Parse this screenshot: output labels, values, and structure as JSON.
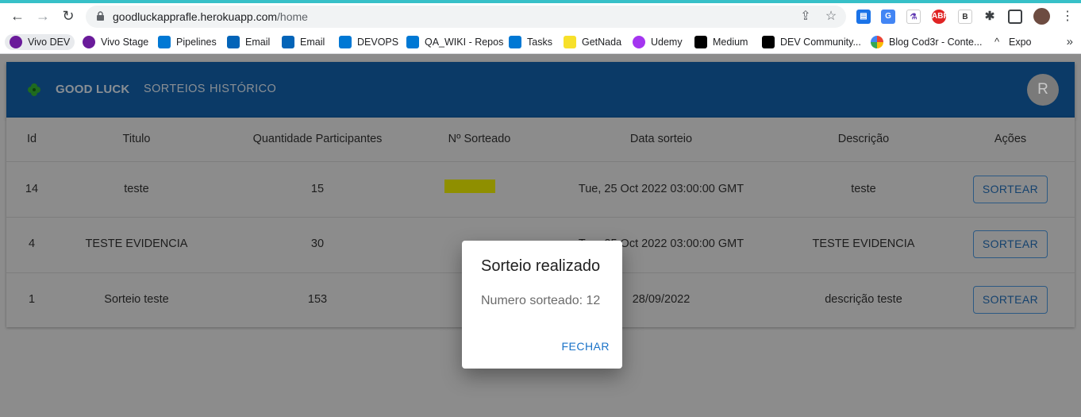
{
  "browser": {
    "url_host": "goodluckapprafle.herokuapp.com",
    "url_path": "/home",
    "bookmarks": [
      {
        "label": "Vivo DEV",
        "icon": "vivo-icon"
      },
      {
        "label": "Vivo Stage",
        "icon": "vivo-icon"
      },
      {
        "label": "Pipelines",
        "icon": "azure-devops-icon"
      },
      {
        "label": "Email",
        "icon": "outlook-icon"
      },
      {
        "label": "Email",
        "icon": "outlook-icon"
      },
      {
        "label": "DEVOPS",
        "icon": "azure-devops-icon"
      },
      {
        "label": "QA_WIKI - Repos",
        "icon": "azure-devops-icon"
      },
      {
        "label": "Tasks",
        "icon": "azure-devops-icon"
      },
      {
        "label": "GetNada",
        "icon": "getnada-icon"
      },
      {
        "label": "Udemy",
        "icon": "udemy-icon"
      },
      {
        "label": "Medium",
        "icon": "medium-icon"
      },
      {
        "label": "DEV Community...",
        "icon": "dev-icon"
      },
      {
        "label": "Blog Cod3r - Conte...",
        "icon": "google-icon"
      },
      {
        "label": "Expo",
        "icon": "expo-icon"
      }
    ]
  },
  "appbar": {
    "brand": "GOOD LUCK",
    "menu": [
      "SORTEIOS",
      "HISTÓRICO"
    ],
    "avatar_initial": "R"
  },
  "table": {
    "headers": [
      "Id",
      "Titulo",
      "Quantidade Participantes",
      "Nº Sorteado",
      "Data sorteio",
      "Descrição",
      "Ações"
    ],
    "rows": [
      {
        "id": "14",
        "titulo": "teste",
        "quantidade": "15",
        "sorteado": "",
        "data": "Tue, 25 Oct 2022 03:00:00 GMT",
        "descricao": "teste",
        "acao": "SORTEAR"
      },
      {
        "id": "4",
        "titulo": "TESTE EVIDENCIA",
        "quantidade": "30",
        "sorteado": "",
        "data": "Tue, 25 Oct 2022 03:00:00 GMT",
        "descricao": "TESTE EVIDENCIA",
        "acao": "SORTEAR"
      },
      {
        "id": "1",
        "titulo": "Sorteio teste",
        "quantidade": "153",
        "sorteado": "",
        "data": "28/09/2022",
        "descricao": "descrição teste",
        "acao": "SORTEAR"
      }
    ]
  },
  "dialog": {
    "title": "Sorteio realizado",
    "label": "Numero sorteado:",
    "value": "12",
    "close_label": "FECHAR"
  },
  "colors": {
    "appbar": "#0b3a67",
    "accent": "#1a73c8",
    "highlight": "#ffff00"
  }
}
